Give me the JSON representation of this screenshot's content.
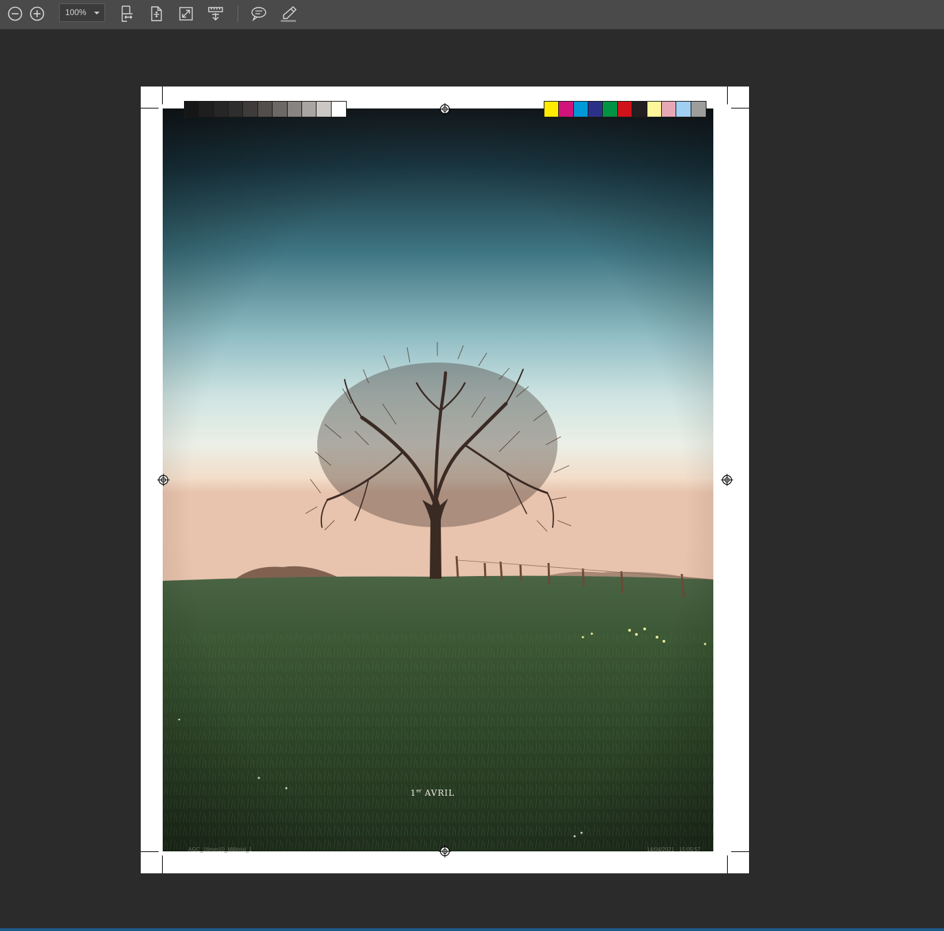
{
  "toolbar": {
    "zoom_value": "100%",
    "icons": [
      "zoom-out-icon",
      "zoom-in-icon",
      "fit-width-icon",
      "fit-page-icon",
      "full-screen-icon",
      "ruler-icon",
      "comment-icon",
      "highlighter-icon"
    ]
  },
  "page": {
    "caption_number": "1",
    "caption_sup": "er",
    "caption_text": "AVRIL",
    "footer_left": "AGC_16mm10_Millimid_1",
    "footer_right": "14/04/2021 · 15:05:57",
    "grayscale_swatches": [
      "#161616",
      "#1e1e1e",
      "#262626",
      "#2e2e2e",
      "#3e3b3a",
      "#524e4c",
      "#6c6865",
      "#888481",
      "#a9a5a2",
      "#cac7c5",
      "#ffffff"
    ],
    "color_swatches": [
      "#ffec00",
      "#d2137a",
      "#0099d8",
      "#2b3189",
      "#009245",
      "#d0121b",
      "#231f20",
      "#fff69a",
      "#e8a7b4",
      "#9fcff2",
      "#9d9d9c"
    ]
  }
}
